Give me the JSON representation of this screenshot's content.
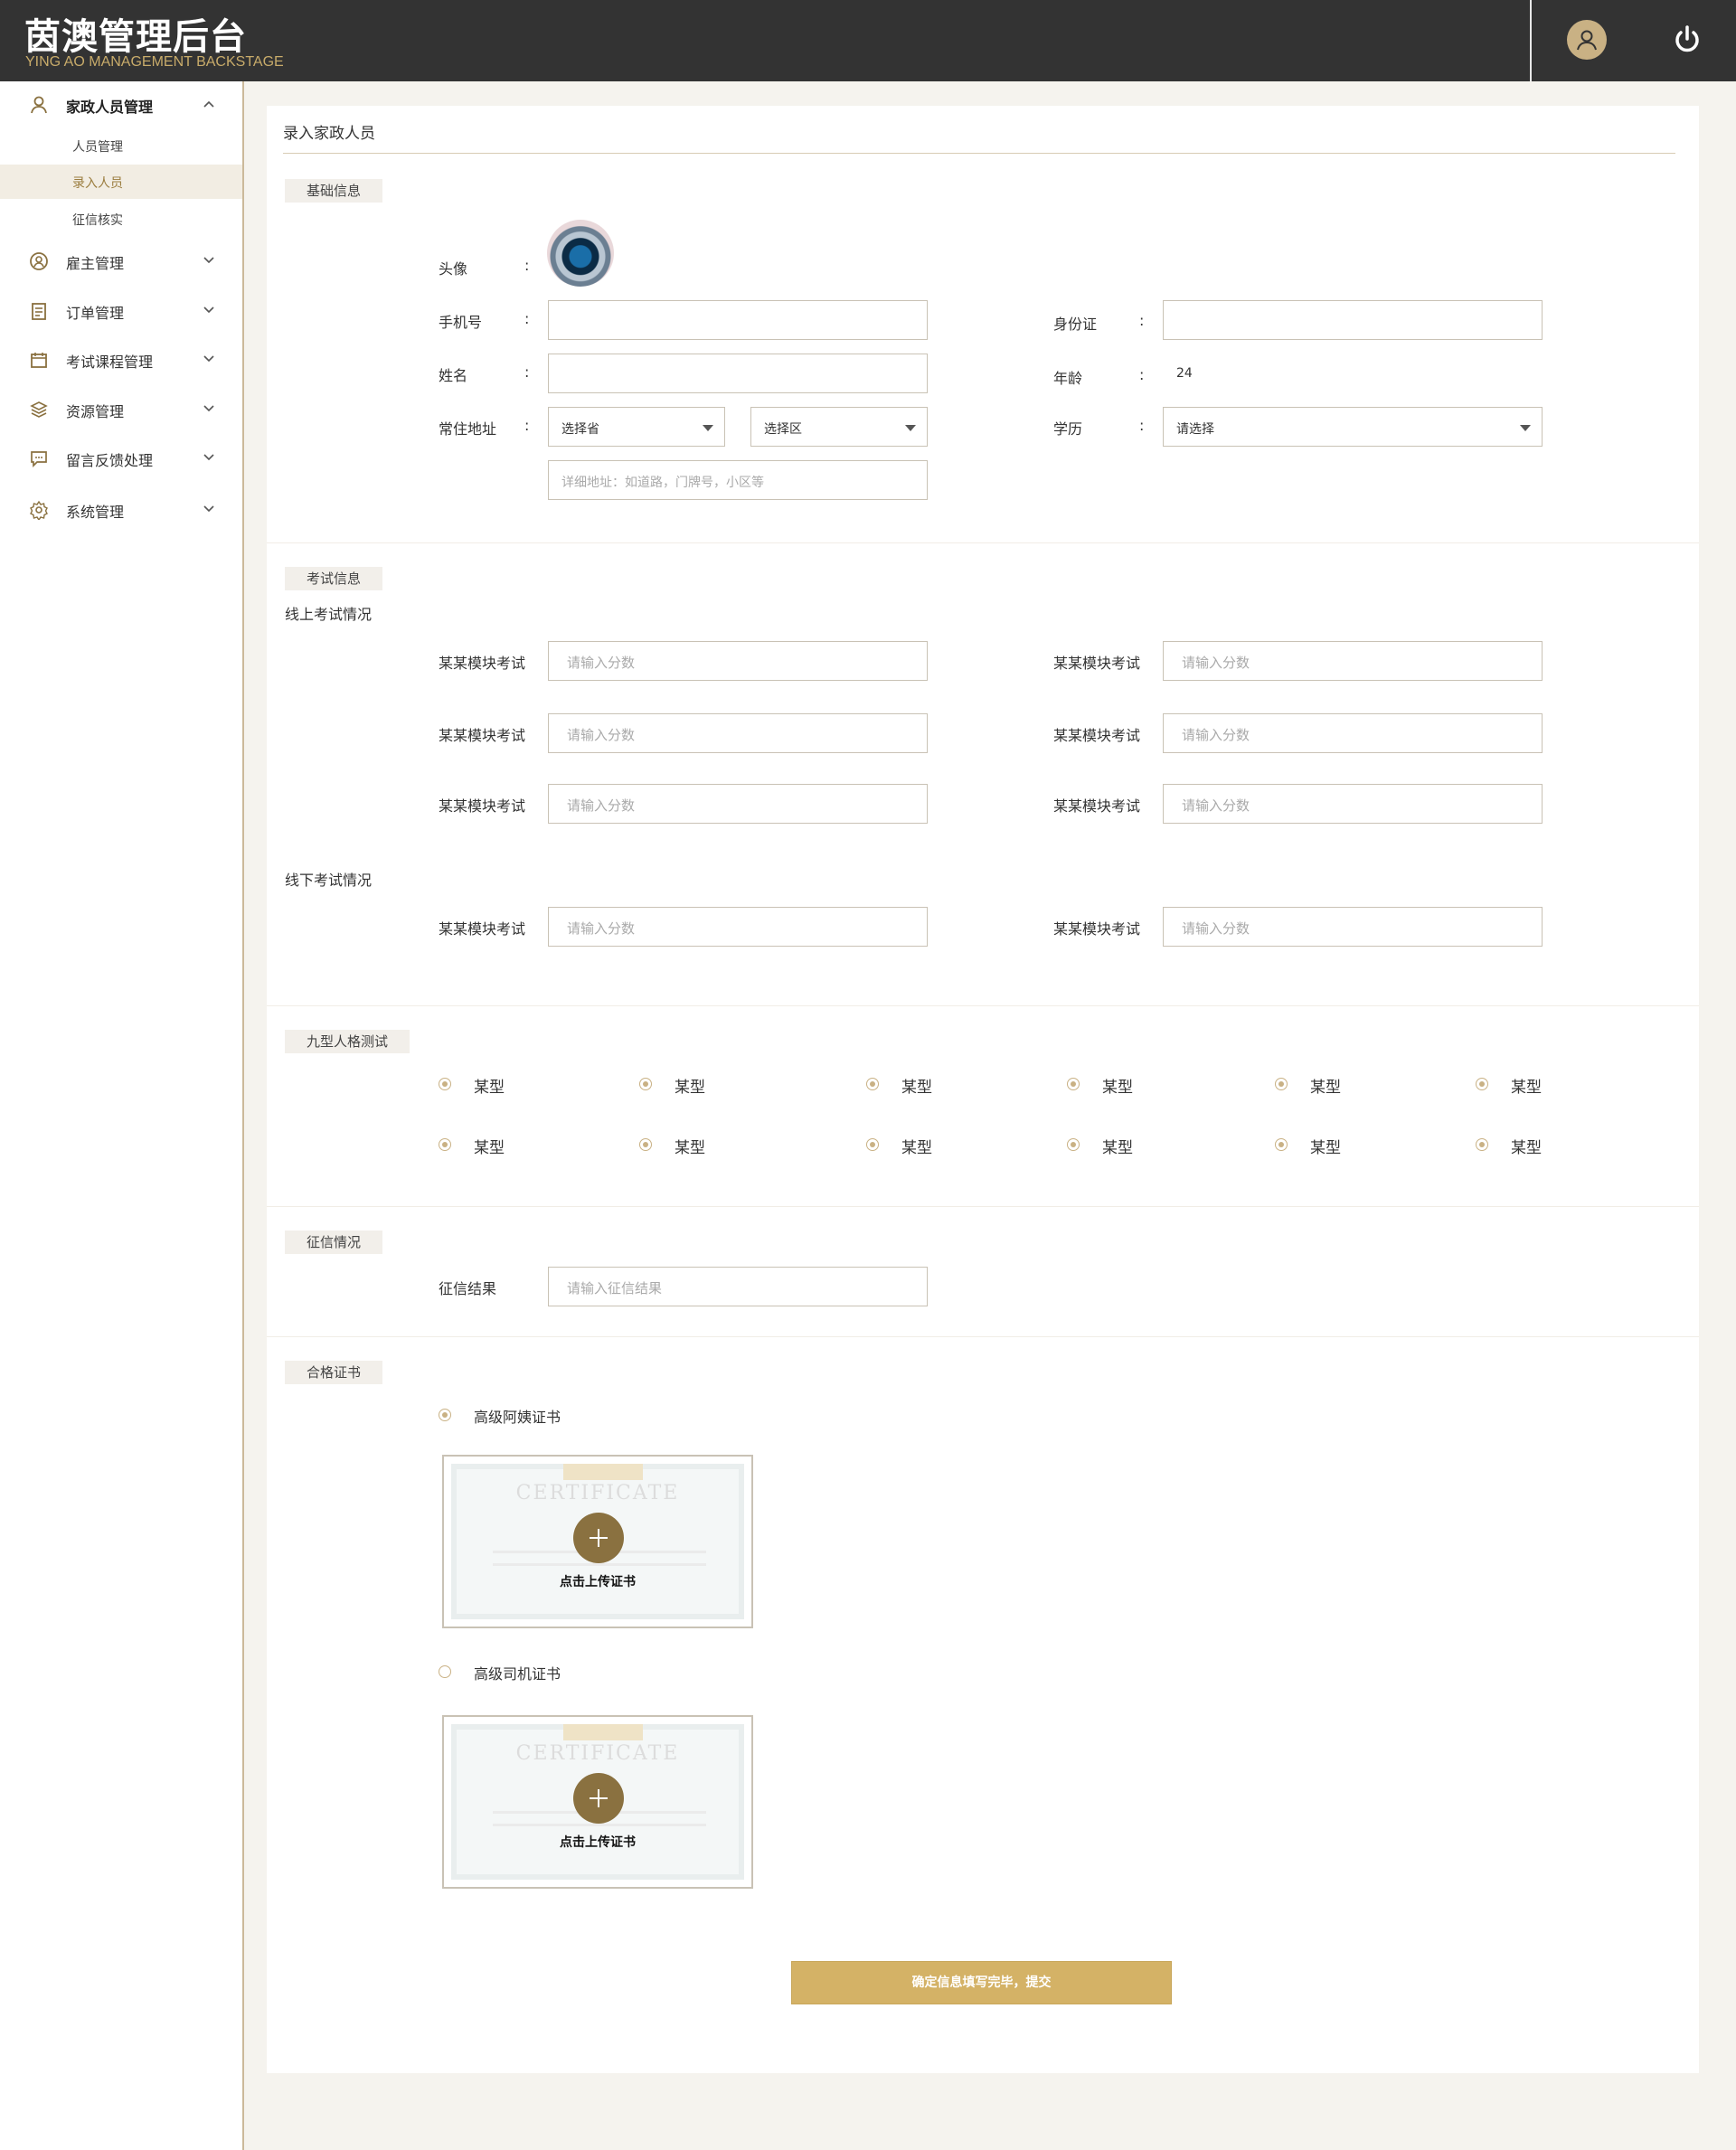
{
  "header": {
    "title": "茵澳管理后台",
    "subtitle": "YING AO MANAGEMENT BACKSTAGE",
    "bg_color": "#333333",
    "accent_color": "#c9b184",
    "user_icon": "user-icon",
    "power_icon": "power-icon"
  },
  "sidebar": {
    "items": [
      {
        "label": "家政人员管理",
        "icon": "housekeeper-icon",
        "expanded": true,
        "children": [
          {
            "label": "人员管理",
            "selected": false
          },
          {
            "label": "录入人员",
            "selected": true
          },
          {
            "label": "征信核实",
            "selected": false
          }
        ]
      },
      {
        "label": "雇主管理",
        "icon": "employer-icon"
      },
      {
        "label": "订单管理",
        "icon": "order-icon"
      },
      {
        "label": "考试课程管理",
        "icon": "calendar-icon"
      },
      {
        "label": "资源管理",
        "icon": "layers-icon"
      },
      {
        "label": "留言反馈处理",
        "icon": "message-icon"
      },
      {
        "label": "系统管理",
        "icon": "gear-icon"
      }
    ]
  },
  "page": {
    "title": "录入家政人员"
  },
  "basic": {
    "tag": "基础信息",
    "avatar_label": "头像",
    "colon": ":",
    "phone_label": "手机号",
    "phone_value": "",
    "id_label": "身份证",
    "id_value": "",
    "name_label": "姓名",
    "name_value": "",
    "age_label": "年龄",
    "age_value": "24",
    "address_label": "常住地址",
    "province_select": "选择省",
    "district_select": "选择区",
    "address_placeholder": "详细地址：如道路，门牌号，小区等",
    "education_label": "学历",
    "education_select": "请选择"
  },
  "exam": {
    "tag": "考试信息",
    "online_heading": "线上考试情况",
    "offline_heading": "线下考试情况",
    "module_label": "某某模块考试",
    "score_placeholder": "请输入分数"
  },
  "personality": {
    "tag": "九型人格测试",
    "option_label": "某型"
  },
  "credit": {
    "tag": "征信情况",
    "result_label": "征信结果",
    "result_placeholder": "请输入征信结果"
  },
  "cert": {
    "tag": "合格证书",
    "options": [
      {
        "label": "高级阿姨证书",
        "selected": true
      },
      {
        "label": "高级司机证书",
        "selected": false
      }
    ],
    "upload_caption": "点击上传证书",
    "placeholder_title": "CERTIFICATE"
  },
  "submit_label": "确定信息填写完毕，提交"
}
